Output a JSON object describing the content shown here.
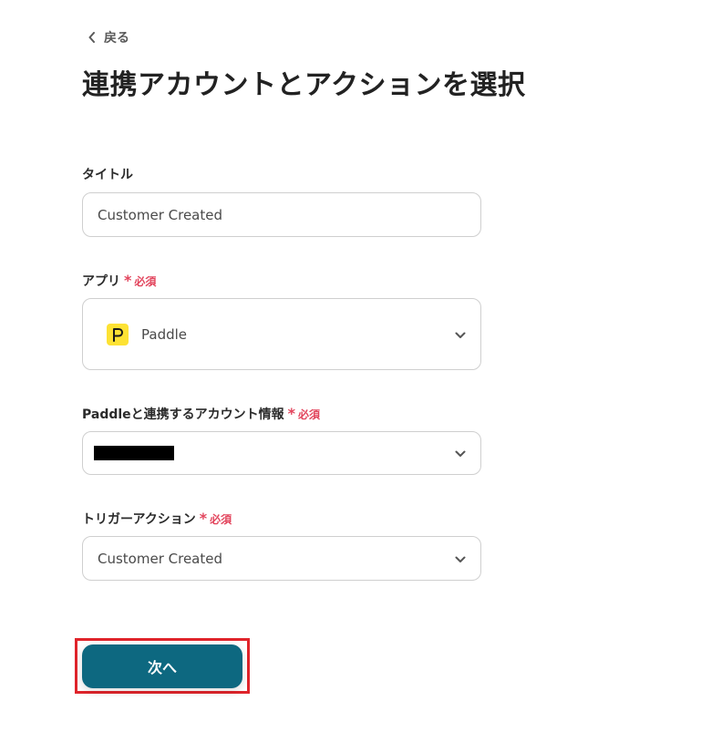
{
  "nav": {
    "back_label": "戻る"
  },
  "page": {
    "title": "連携アカウントとアクションを選択"
  },
  "form": {
    "title_field": {
      "label": "タイトル",
      "value": "Customer Created"
    },
    "app_field": {
      "label": "アプリ",
      "required_label": "必須",
      "selected_app": "Paddle",
      "app_logo_color": "#fde234"
    },
    "account_field": {
      "label": "Paddleと連携するアカウント情報",
      "required_label": "必須"
    },
    "trigger_field": {
      "label": "トリガーアクション",
      "required_label": "必須",
      "value": "Customer Created"
    }
  },
  "actions": {
    "next_label": "次へ",
    "next_color": "#0d6880"
  },
  "colors": {
    "required": "#e2445c",
    "highlight": "#e0242b"
  }
}
